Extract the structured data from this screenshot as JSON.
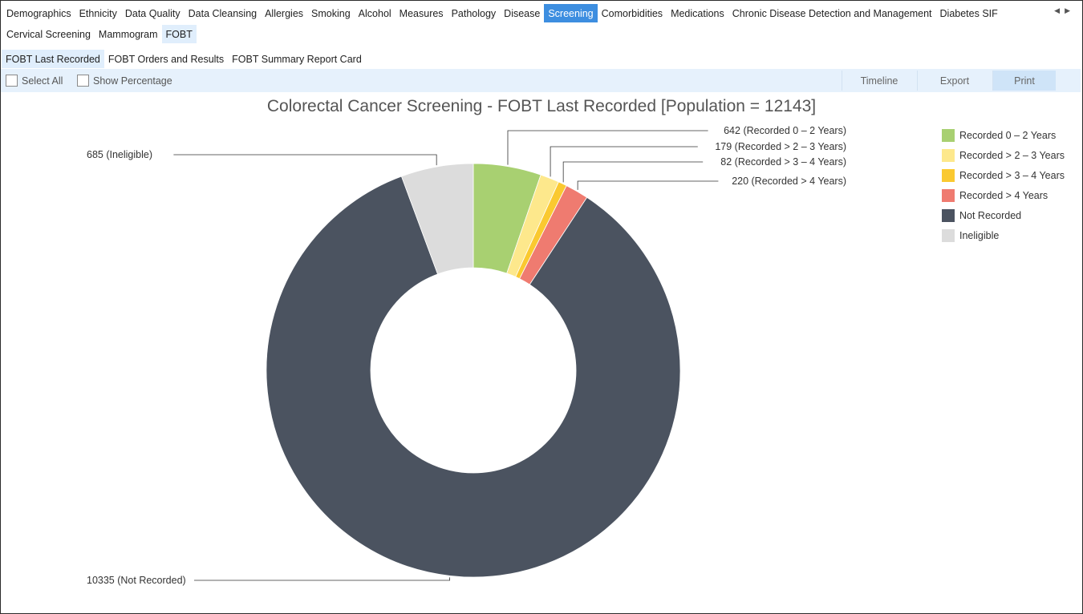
{
  "nav": {
    "tabs": [
      {
        "label": "Demographics"
      },
      {
        "label": "Ethnicity"
      },
      {
        "label": "Data Quality"
      },
      {
        "label": "Data Cleansing"
      },
      {
        "label": "Allergies"
      },
      {
        "label": "Smoking"
      },
      {
        "label": "Alcohol"
      },
      {
        "label": "Measures"
      },
      {
        "label": "Pathology"
      },
      {
        "label": "Disease"
      },
      {
        "label": "Screening"
      },
      {
        "label": "Comorbidities"
      },
      {
        "label": "Medications"
      },
      {
        "label": "Chronic Disease Detection and Management"
      },
      {
        "label": "Diabetes SIF"
      }
    ],
    "active": "Screening",
    "scroll_left": "◀",
    "scroll_right": "▶"
  },
  "subnav": {
    "tabs": [
      {
        "label": "Cervical Screening"
      },
      {
        "label": "Mammogram"
      },
      {
        "label": "FOBT"
      }
    ],
    "active": "FOBT"
  },
  "subsubnav": {
    "tabs": [
      {
        "label": "FOBT Last Recorded"
      },
      {
        "label": "FOBT Orders and Results"
      },
      {
        "label": "FOBT Summary Report Card"
      }
    ],
    "active": "FOBT Last Recorded"
  },
  "toolbar": {
    "select_all": "Select All",
    "show_percentage": "Show Percentage",
    "timeline": "Timeline",
    "export": "Export",
    "print": "Print"
  },
  "chart_data": {
    "type": "pie",
    "donut": true,
    "title": "Colorectal Cancer Screening - FOBT Last Recorded [Population = 12143]",
    "legend_position": "top-right",
    "slices": [
      {
        "name": "Recorded 0 – 2 Years",
        "value": 642,
        "color": "#a8d071",
        "label": "642 (Recorded 0 – 2 Years)"
      },
      {
        "name": "Recorded > 2 – 3 Years",
        "value": 179,
        "color": "#fde88c",
        "label": "179 (Recorded > 2 – 3 Years)"
      },
      {
        "name": "Recorded > 3 – 4 Years",
        "value": 82,
        "color": "#fac930",
        "label": "82 (Recorded > 3 – 4 Years)"
      },
      {
        "name": "Recorded > 4 Years",
        "value": 220,
        "color": "#ef7b70",
        "label": "220 (Recorded > 4 Years)"
      },
      {
        "name": "Not Recorded",
        "value": 10335,
        "color": "#4b5360",
        "label": "10335 (Not Recorded)"
      },
      {
        "name": "Ineligible",
        "value": 685,
        "color": "#dcdcdc",
        "label": "685 (Ineligible)"
      }
    ]
  }
}
